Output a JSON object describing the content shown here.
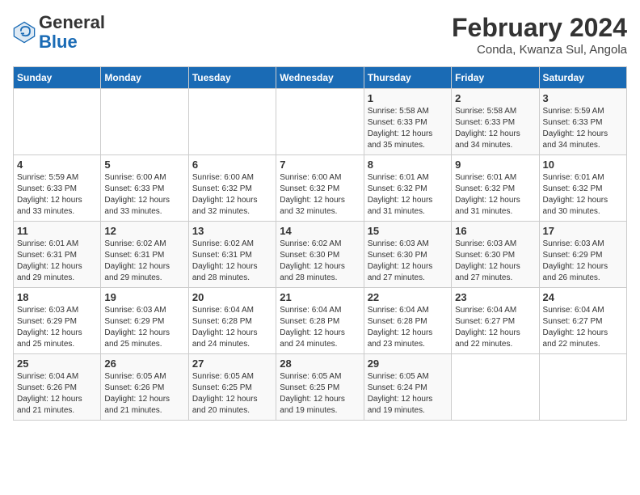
{
  "header": {
    "logo_general": "General",
    "logo_blue": "Blue",
    "month_year": "February 2024",
    "location": "Conda, Kwanza Sul, Angola"
  },
  "days_of_week": [
    "Sunday",
    "Monday",
    "Tuesday",
    "Wednesday",
    "Thursday",
    "Friday",
    "Saturday"
  ],
  "weeks": [
    [
      {
        "day": "",
        "sunrise": "",
        "sunset": "",
        "daylight": ""
      },
      {
        "day": "",
        "sunrise": "",
        "sunset": "",
        "daylight": ""
      },
      {
        "day": "",
        "sunrise": "",
        "sunset": "",
        "daylight": ""
      },
      {
        "day": "",
        "sunrise": "",
        "sunset": "",
        "daylight": ""
      },
      {
        "day": "1",
        "sunrise": "Sunrise: 5:58 AM",
        "sunset": "Sunset: 6:33 PM",
        "daylight": "Daylight: 12 hours and 35 minutes."
      },
      {
        "day": "2",
        "sunrise": "Sunrise: 5:58 AM",
        "sunset": "Sunset: 6:33 PM",
        "daylight": "Daylight: 12 hours and 34 minutes."
      },
      {
        "day": "3",
        "sunrise": "Sunrise: 5:59 AM",
        "sunset": "Sunset: 6:33 PM",
        "daylight": "Daylight: 12 hours and 34 minutes."
      }
    ],
    [
      {
        "day": "4",
        "sunrise": "Sunrise: 5:59 AM",
        "sunset": "Sunset: 6:33 PM",
        "daylight": "Daylight: 12 hours and 33 minutes."
      },
      {
        "day": "5",
        "sunrise": "Sunrise: 6:00 AM",
        "sunset": "Sunset: 6:33 PM",
        "daylight": "Daylight: 12 hours and 33 minutes."
      },
      {
        "day": "6",
        "sunrise": "Sunrise: 6:00 AM",
        "sunset": "Sunset: 6:32 PM",
        "daylight": "Daylight: 12 hours and 32 minutes."
      },
      {
        "day": "7",
        "sunrise": "Sunrise: 6:00 AM",
        "sunset": "Sunset: 6:32 PM",
        "daylight": "Daylight: 12 hours and 32 minutes."
      },
      {
        "day": "8",
        "sunrise": "Sunrise: 6:01 AM",
        "sunset": "Sunset: 6:32 PM",
        "daylight": "Daylight: 12 hours and 31 minutes."
      },
      {
        "day": "9",
        "sunrise": "Sunrise: 6:01 AM",
        "sunset": "Sunset: 6:32 PM",
        "daylight": "Daylight: 12 hours and 31 minutes."
      },
      {
        "day": "10",
        "sunrise": "Sunrise: 6:01 AM",
        "sunset": "Sunset: 6:32 PM",
        "daylight": "Daylight: 12 hours and 30 minutes."
      }
    ],
    [
      {
        "day": "11",
        "sunrise": "Sunrise: 6:01 AM",
        "sunset": "Sunset: 6:31 PM",
        "daylight": "Daylight: 12 hours and 29 minutes."
      },
      {
        "day": "12",
        "sunrise": "Sunrise: 6:02 AM",
        "sunset": "Sunset: 6:31 PM",
        "daylight": "Daylight: 12 hours and 29 minutes."
      },
      {
        "day": "13",
        "sunrise": "Sunrise: 6:02 AM",
        "sunset": "Sunset: 6:31 PM",
        "daylight": "Daylight: 12 hours and 28 minutes."
      },
      {
        "day": "14",
        "sunrise": "Sunrise: 6:02 AM",
        "sunset": "Sunset: 6:30 PM",
        "daylight": "Daylight: 12 hours and 28 minutes."
      },
      {
        "day": "15",
        "sunrise": "Sunrise: 6:03 AM",
        "sunset": "Sunset: 6:30 PM",
        "daylight": "Daylight: 12 hours and 27 minutes."
      },
      {
        "day": "16",
        "sunrise": "Sunrise: 6:03 AM",
        "sunset": "Sunset: 6:30 PM",
        "daylight": "Daylight: 12 hours and 27 minutes."
      },
      {
        "day": "17",
        "sunrise": "Sunrise: 6:03 AM",
        "sunset": "Sunset: 6:29 PM",
        "daylight": "Daylight: 12 hours and 26 minutes."
      }
    ],
    [
      {
        "day": "18",
        "sunrise": "Sunrise: 6:03 AM",
        "sunset": "Sunset: 6:29 PM",
        "daylight": "Daylight: 12 hours and 25 minutes."
      },
      {
        "day": "19",
        "sunrise": "Sunrise: 6:03 AM",
        "sunset": "Sunset: 6:29 PM",
        "daylight": "Daylight: 12 hours and 25 minutes."
      },
      {
        "day": "20",
        "sunrise": "Sunrise: 6:04 AM",
        "sunset": "Sunset: 6:28 PM",
        "daylight": "Daylight: 12 hours and 24 minutes."
      },
      {
        "day": "21",
        "sunrise": "Sunrise: 6:04 AM",
        "sunset": "Sunset: 6:28 PM",
        "daylight": "Daylight: 12 hours and 24 minutes."
      },
      {
        "day": "22",
        "sunrise": "Sunrise: 6:04 AM",
        "sunset": "Sunset: 6:28 PM",
        "daylight": "Daylight: 12 hours and 23 minutes."
      },
      {
        "day": "23",
        "sunrise": "Sunrise: 6:04 AM",
        "sunset": "Sunset: 6:27 PM",
        "daylight": "Daylight: 12 hours and 22 minutes."
      },
      {
        "day": "24",
        "sunrise": "Sunrise: 6:04 AM",
        "sunset": "Sunset: 6:27 PM",
        "daylight": "Daylight: 12 hours and 22 minutes."
      }
    ],
    [
      {
        "day": "25",
        "sunrise": "Sunrise: 6:04 AM",
        "sunset": "Sunset: 6:26 PM",
        "daylight": "Daylight: 12 hours and 21 minutes."
      },
      {
        "day": "26",
        "sunrise": "Sunrise: 6:05 AM",
        "sunset": "Sunset: 6:26 PM",
        "daylight": "Daylight: 12 hours and 21 minutes."
      },
      {
        "day": "27",
        "sunrise": "Sunrise: 6:05 AM",
        "sunset": "Sunset: 6:25 PM",
        "daylight": "Daylight: 12 hours and 20 minutes."
      },
      {
        "day": "28",
        "sunrise": "Sunrise: 6:05 AM",
        "sunset": "Sunset: 6:25 PM",
        "daylight": "Daylight: 12 hours and 19 minutes."
      },
      {
        "day": "29",
        "sunrise": "Sunrise: 6:05 AM",
        "sunset": "Sunset: 6:24 PM",
        "daylight": "Daylight: 12 hours and 19 minutes."
      },
      {
        "day": "",
        "sunrise": "",
        "sunset": "",
        "daylight": ""
      },
      {
        "day": "",
        "sunrise": "",
        "sunset": "",
        "daylight": ""
      }
    ]
  ]
}
